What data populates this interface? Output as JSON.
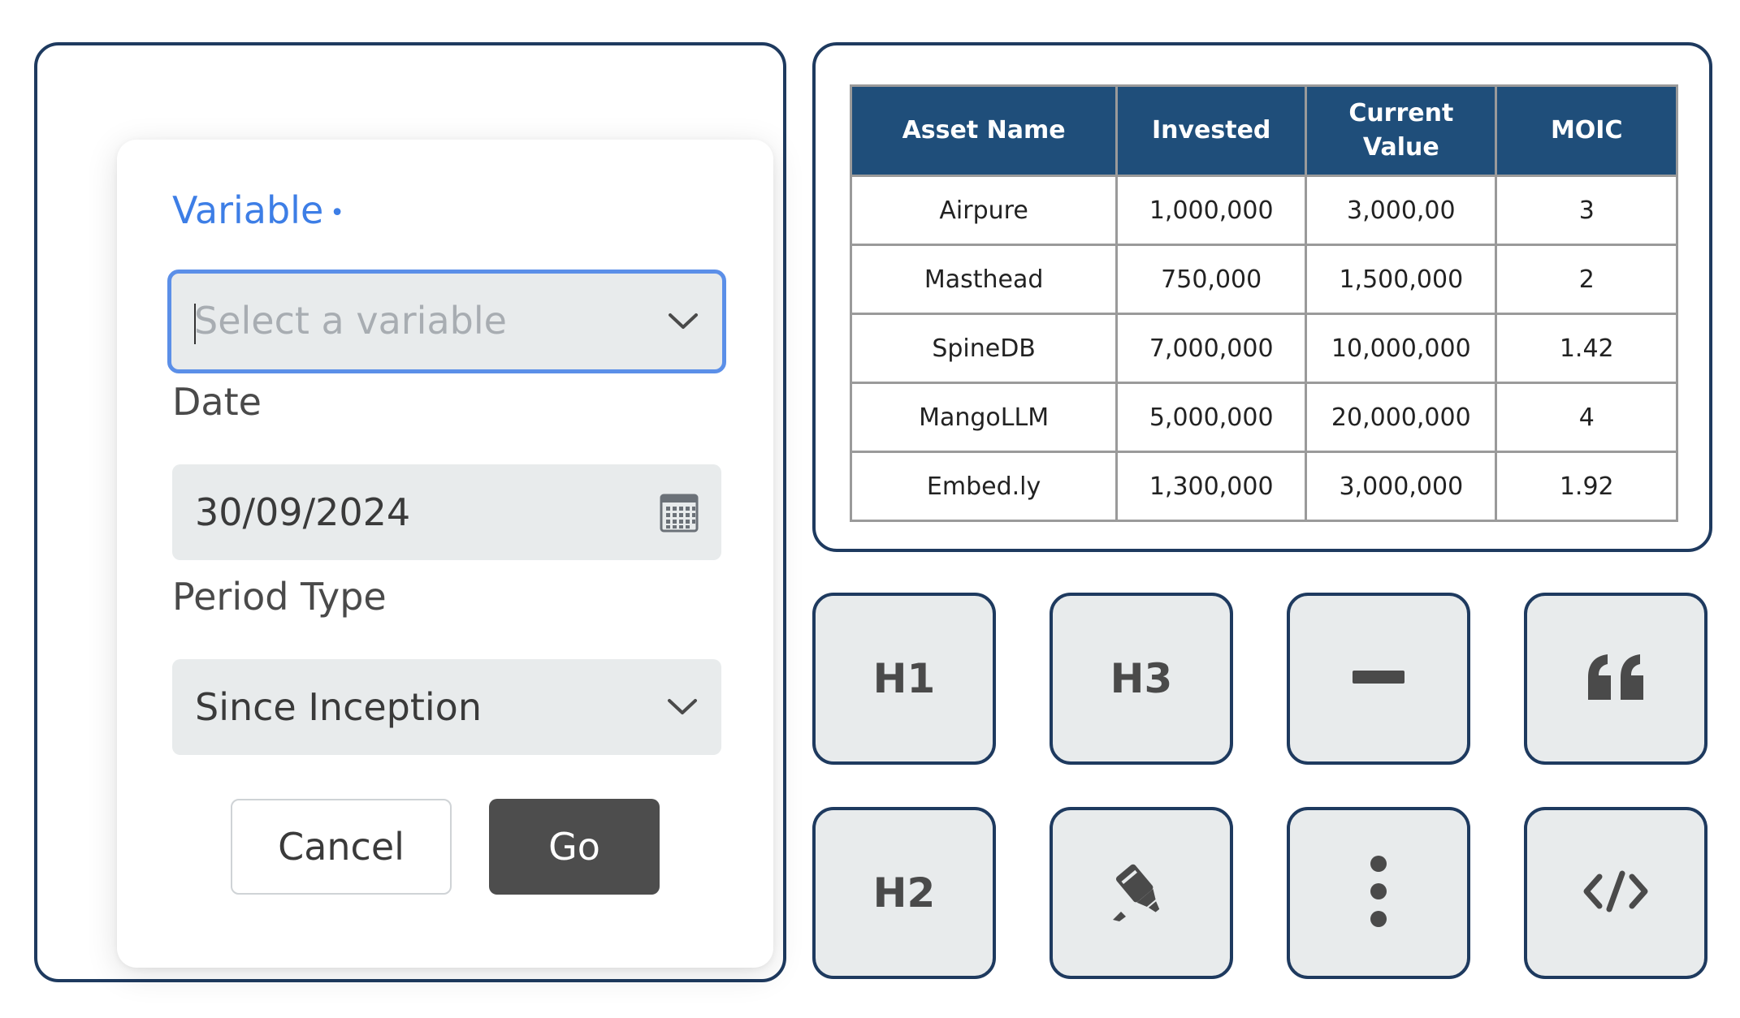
{
  "form": {
    "variable_label": "Variable",
    "variable_required_marker": "•",
    "variable_placeholder": "Select a variable",
    "date_label": "Date",
    "date_value": "30/09/2024",
    "period_label": "Period Type",
    "period_value": "Since Inception",
    "cancel_label": "Cancel",
    "go_label": "Go"
  },
  "table": {
    "headers": [
      "Asset Name",
      "Invested",
      "Current Value",
      "MOIC"
    ],
    "rows": [
      [
        "Airpure",
        "1,000,000",
        "3,000,00",
        "3"
      ],
      [
        "Masthead",
        "750,000",
        "1,500,000",
        "2"
      ],
      [
        "SpineDB",
        "7,000,000",
        "10,000,000",
        "1.42"
      ],
      [
        "MangoLLM",
        "5,000,000",
        "20,000,000",
        "4"
      ],
      [
        "Embed.ly",
        "1,300,000",
        "3,000,000",
        "1.92"
      ]
    ]
  },
  "toolbar": {
    "h1_label": "H1",
    "h3_label": "H3",
    "h2_label": "H2",
    "icons": [
      "horizontal-rule-icon",
      "quote-icon",
      "highlighter-icon",
      "more-vertical-icon",
      "code-icon"
    ]
  },
  "colors": {
    "panel_border": "#1e3a5f",
    "table_header": "#1f4e7a",
    "accent": "#3d7ee6",
    "go_button": "#4d4d4d",
    "input_bg": "#e8ebec"
  }
}
